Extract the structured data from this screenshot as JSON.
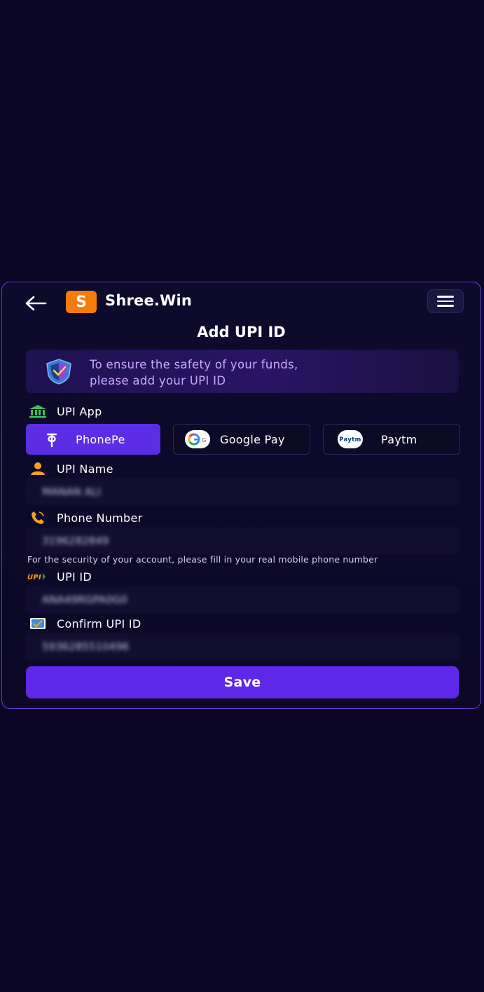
{
  "header": {
    "logo_letter": "S",
    "brand": "Shree.Win"
  },
  "page_title": "Add UPI ID",
  "notice": {
    "line1": "To ensure the safety of your funds,",
    "line2": "please add your UPI ID"
  },
  "upi_app": {
    "label": "UPI App",
    "options": [
      {
        "label": "PhonePe",
        "selected": true
      },
      {
        "label": "Google Pay",
        "selected": false
      },
      {
        "label": "Paytm",
        "selected": false
      }
    ],
    "paytm_logo_text": "Paytm",
    "gpay_logo_text": "G"
  },
  "fields": {
    "upi_name": {
      "label": "UPI Name",
      "value": "MANAN ALI"
    },
    "phone": {
      "label": "Phone Number",
      "value": "3196282849"
    },
    "phone_hint": "For the security of your account, please fill in your real mobile phone number",
    "upi_id": {
      "label": "UPI ID",
      "value": "ANA49RGPA0G0",
      "logo_text": "UPI"
    },
    "confirm_upi_id": {
      "label": "Confirm UPI ID",
      "value": "5936285510496"
    }
  },
  "save_label": "Save",
  "colors": {
    "background": "#0a0624",
    "accent": "#5b2ee6",
    "logo": "#f57c0a",
    "notice_text": "#c9a8ff"
  }
}
